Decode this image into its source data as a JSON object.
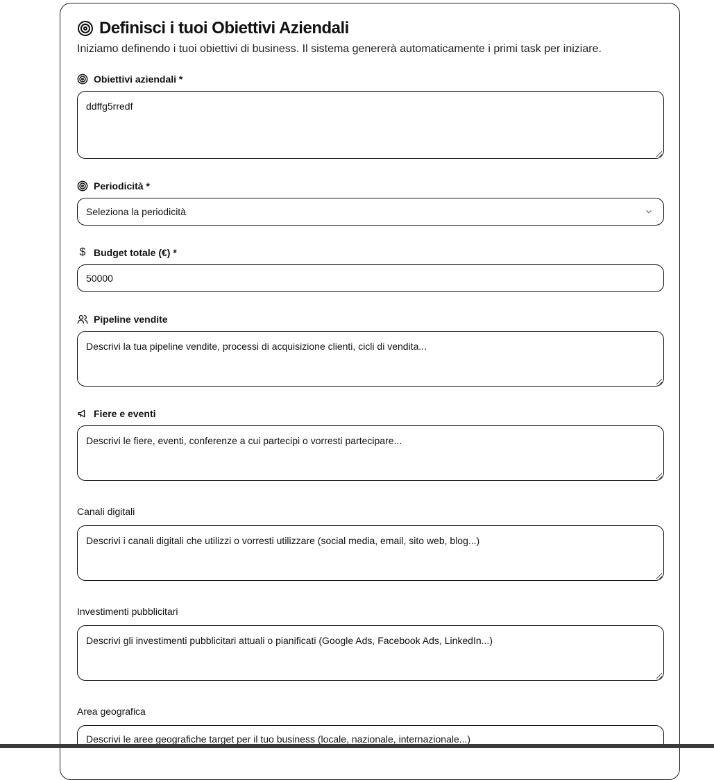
{
  "header": {
    "title": "Definisci i tuoi Obiettivi Aziendali",
    "subtitle": "Iniziamo definendo i tuoi obiettivi di business. Il sistema genererà automaticamente i primi task per iniziare."
  },
  "fields": {
    "obiettivi": {
      "label": "Obiettivi aziendali *",
      "value": "ddffg5rredf",
      "icon": "target-icon"
    },
    "periodicita": {
      "label": "Periodicità *",
      "selected": "Seleziona la periodicità",
      "icon": "target-icon"
    },
    "budget": {
      "label": "Budget totale (€) *",
      "value": "50000",
      "icon_glyph": "$",
      "icon": "dollar-icon"
    },
    "pipeline": {
      "label": "Pipeline vendite",
      "placeholder": "Descrivi la tua pipeline vendite, processi di acquisizione clienti, cicli di vendita...",
      "icon": "users-icon"
    },
    "fiere": {
      "label": "Fiere e eventi",
      "placeholder": "Descrivi le fiere, eventi, conferenze a cui partecipi o vorresti partecipare...",
      "icon": "megaphone-icon"
    },
    "canali": {
      "label": "Canali digitali",
      "placeholder": "Descrivi i canali digitali che utilizzi o vorresti utilizzare (social media, email, sito web, blog...)"
    },
    "investimenti": {
      "label": "Investimenti pubblicitari",
      "placeholder": "Descrivi gli investimenti pubblicitari attuali o pianificati (Google Ads, Facebook Ads, LinkedIn...)"
    },
    "area": {
      "label": "Area geografica",
      "placeholder": "Descrivi le aree geografiche target per il tuo business (locale, nazionale, internazionale...)"
    }
  }
}
